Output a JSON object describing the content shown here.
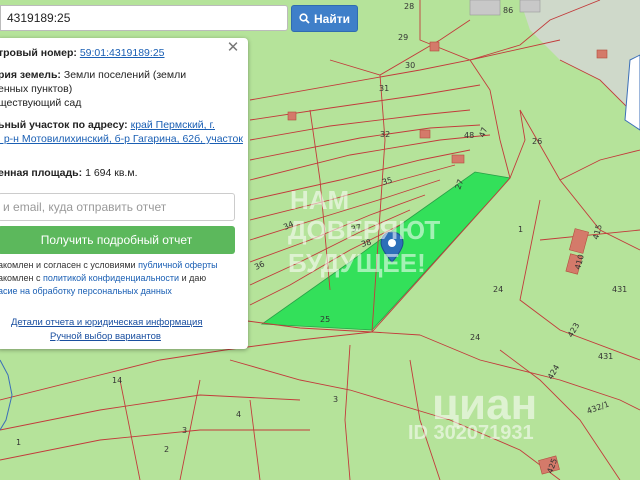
{
  "search": {
    "value": "4319189:25",
    "button_label": "Найти"
  },
  "panel": {
    "cadastral_label": "тровый номер:",
    "cadastral_value": "59:01:4319189:25",
    "category_label": "рия земель:",
    "category_value_1": "Земли поселений (земли",
    "category_value_2": "енных пунктов)",
    "use_value": "ществующий сад",
    "address_label": "ьный участок по адресу:",
    "address_value_1": "край Пермский, г.",
    "address_value_2": ", р-н Мотовилихинский, б-р Гагарина, 62б, участок",
    "area_label": "енная площадь:",
    "area_value": "1 694 кв.м.",
    "email_placeholder": "и email, куда отправить отчет",
    "report_button": "Получить подробный отчет",
    "consent_1a": "акомлен и согласен с условиями ",
    "consent_1b": "публичной оферты",
    "consent_2a": "акомлен с ",
    "consent_2b": "политикой конфиденциальности",
    "consent_2c": " и даю",
    "consent_3": "асие на обработку персональных данных",
    "details_link": "Детали отчета и юридическая информация",
    "manual_link": "Ручной выбор вариантов"
  },
  "map_labels": [
    "28",
    "86",
    "29",
    "30",
    "31",
    "32",
    "35",
    "37",
    "38",
    "34",
    "36",
    "25",
    "48",
    "47",
    "26",
    "27",
    "1",
    "24",
    "24",
    "415",
    "410",
    "431",
    "431",
    "423",
    "424",
    "432/1",
    "425",
    "14",
    "3",
    "4",
    "3",
    "2",
    "1"
  ],
  "watermark": {
    "line1": "НАМ",
    "line2": "ДОВЕРЯЮТ",
    "line3": "БУДУЩЕЕ!",
    "cian": "циан",
    "id": "ID 302071931"
  },
  "colors": {
    "map_bg": "#b5e39a",
    "highlight": "#33e05a",
    "boundary": "#c23b3b",
    "accent": "#3f7fc9",
    "report_button": "#5cb85c"
  },
  "icons": [
    "search-icon",
    "close-icon",
    "map-pin-icon"
  ]
}
